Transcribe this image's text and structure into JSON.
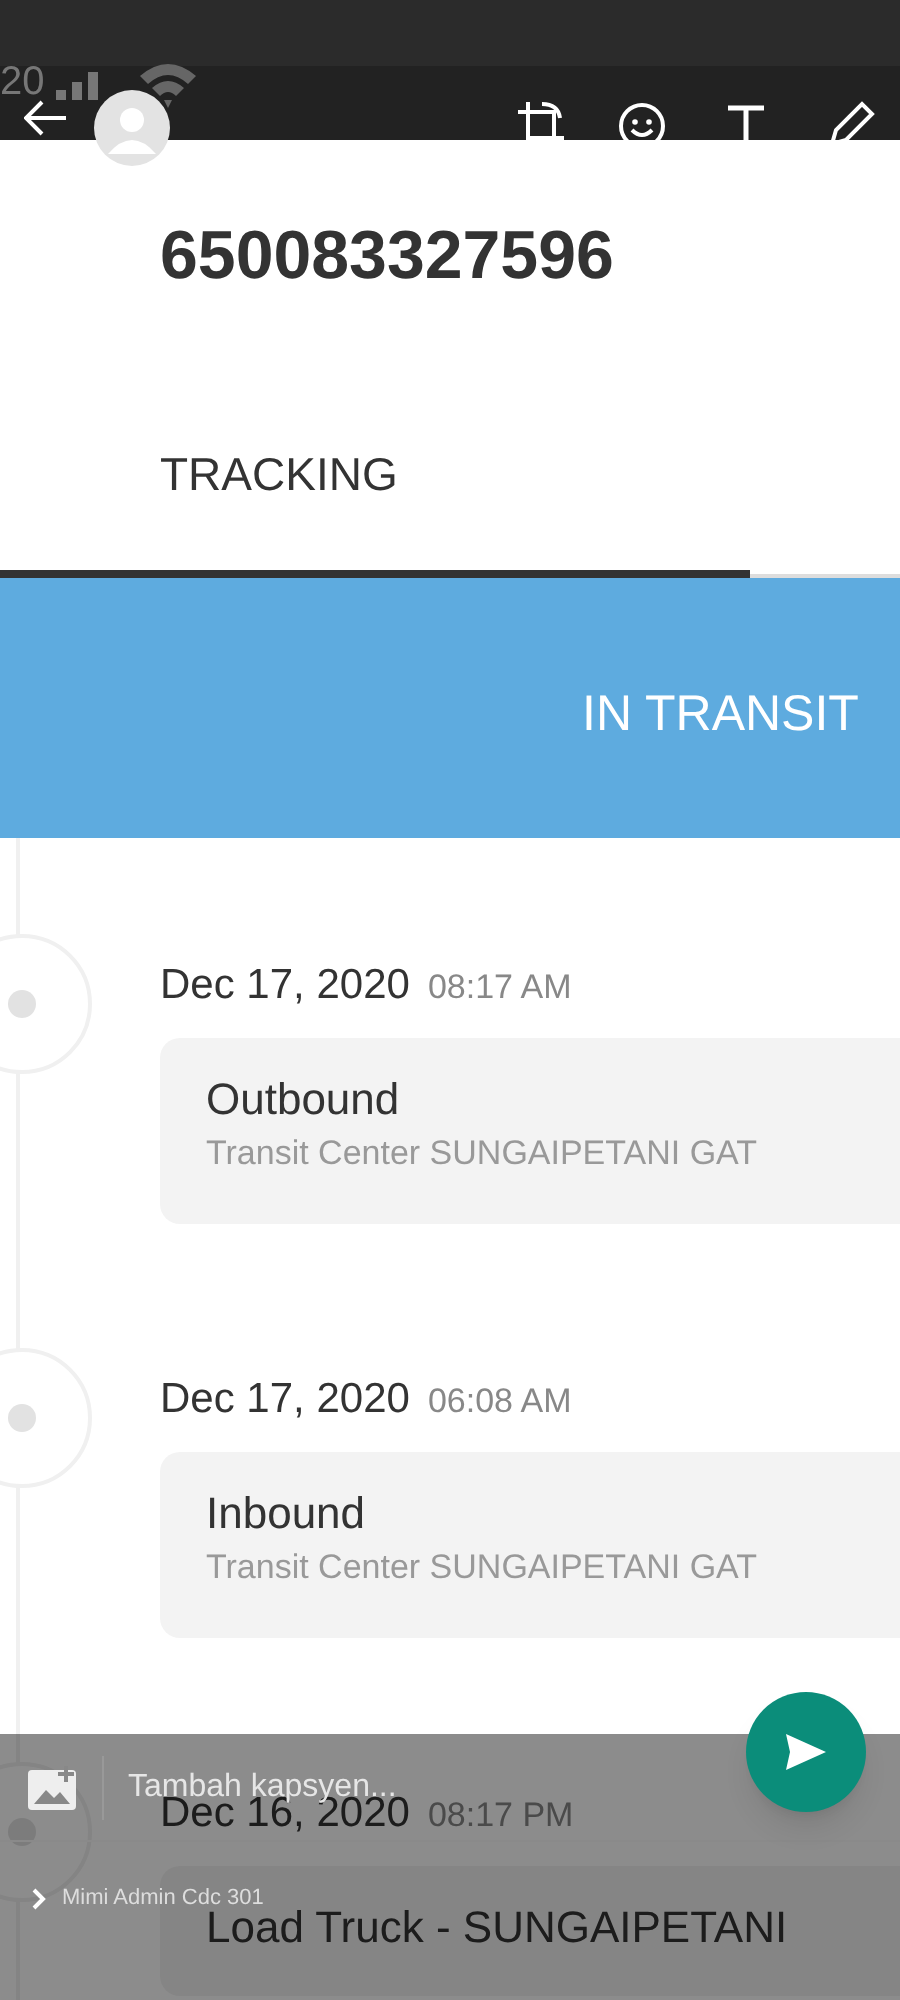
{
  "status_bar": {
    "time": "20"
  },
  "tracking_number": "650083327596",
  "tabs": [
    {
      "label": "TRACKING",
      "selected": true
    }
  ],
  "status_banner": "IN TRANSIT",
  "events": [
    {
      "date": "Dec 17, 2020",
      "time": "08:17 AM",
      "title": "Outbound",
      "location": "Transit Center SUNGAIPETANI GAT"
    },
    {
      "date": "Dec 17, 2020",
      "time": "06:08 AM",
      "title": "Inbound",
      "location": "Transit Center SUNGAIPETANI GAT"
    },
    {
      "date": "Dec 16, 2020",
      "time": "08:17 PM",
      "title": "Load Truck - SUNGAIPETANI"
    }
  ],
  "caption": {
    "placeholder": "Tambah kapsyen..."
  },
  "recipient": {
    "label": "Mimi Admin Cdc 301"
  }
}
